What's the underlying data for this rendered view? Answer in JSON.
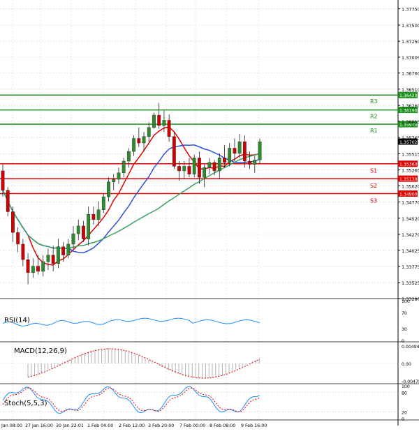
{
  "chart_data": {
    "type": "candlestick",
    "price": {
      "ylim": [
        1.3328,
        1.378
      ],
      "ticks": [
        "1.37750",
        "1.37500",
        "1.37250",
        "1.37005",
        "1.36760",
        "1.36510",
        "1.36260",
        "1.36015",
        "1.35765",
        "1.35515",
        "1.35265",
        "1.35020",
        "1.34770",
        "1.34520",
        "1.34270",
        "1.34025",
        "1.33775",
        "1.33525",
        "1.33280"
      ],
      "current": {
        "value": 1.35702,
        "label": "1.35702"
      },
      "levels": [
        {
          "name": "R3",
          "value": 1.3642,
          "label": "1.36420",
          "color": "#1a8f1a"
        },
        {
          "name": "R2",
          "value": 1.3619,
          "label": "1.36190",
          "color": "#1a8f1a"
        },
        {
          "name": "R1",
          "value": 1.3597,
          "label": "1.35970",
          "color": "#1a8f1a"
        },
        {
          "name": "S1",
          "value": 1.3536,
          "label": "1.35360",
          "color": "#e00000"
        },
        {
          "name": "S2",
          "value": 1.3513,
          "label": "1.35130",
          "color": "#e00000"
        },
        {
          "name": "S3",
          "value": 1.349,
          "label": "1.34900",
          "color": "#e00000"
        }
      ],
      "candles": [
        [
          1.3525,
          1.3535,
          1.3485,
          1.3495
        ],
        [
          1.3495,
          1.35,
          1.3455,
          1.3462
        ],
        [
          1.3462,
          1.347,
          1.3415,
          1.343
        ],
        [
          1.343,
          1.3438,
          1.34,
          1.3412
        ],
        [
          1.3412,
          1.342,
          1.3378,
          1.3388
        ],
        [
          1.3388,
          1.3398,
          1.335,
          1.3368
        ],
        [
          1.3368,
          1.339,
          1.336,
          1.3378
        ],
        [
          1.3378,
          1.3395,
          1.3365,
          1.337
        ],
        [
          1.337,
          1.3395,
          1.3362,
          1.3385
        ],
        [
          1.3385,
          1.3405,
          1.3372,
          1.3395
        ],
        [
          1.3395,
          1.341,
          1.337,
          1.3382
        ],
        [
          1.3382,
          1.342,
          1.3375,
          1.3408
        ],
        [
          1.3408,
          1.3415,
          1.3385,
          1.3395
        ],
        [
          1.3395,
          1.342,
          1.339,
          1.3412
        ],
        [
          1.3412,
          1.344,
          1.3405,
          1.3428
        ],
        [
          1.3428,
          1.345,
          1.3418,
          1.344
        ],
        [
          1.344,
          1.3448,
          1.3415,
          1.342
        ],
        [
          1.342,
          1.347,
          1.341,
          1.3458
        ],
        [
          1.3458,
          1.347,
          1.3442,
          1.345
        ],
        [
          1.345,
          1.3478,
          1.344,
          1.3465
        ],
        [
          1.3465,
          1.349,
          1.346,
          1.3485
        ],
        [
          1.3485,
          1.3515,
          1.3478,
          1.3508
        ],
        [
          1.3508,
          1.352,
          1.3495,
          1.3512
        ],
        [
          1.3512,
          1.353,
          1.3505,
          1.3522
        ],
        [
          1.3522,
          1.3545,
          1.3515,
          1.354
        ],
        [
          1.354,
          1.356,
          1.353,
          1.3555
        ],
        [
          1.3555,
          1.358,
          1.3548,
          1.3575
        ],
        [
          1.3575,
          1.3592,
          1.3562,
          1.3568
        ],
        [
          1.3568,
          1.3585,
          1.3555,
          1.3578
        ],
        [
          1.3578,
          1.36,
          1.357,
          1.3592
        ],
        [
          1.3592,
          1.3615,
          1.359,
          1.3611
        ],
        [
          1.3611,
          1.363,
          1.359,
          1.3595
        ],
        [
          1.3595,
          1.3618,
          1.3585,
          1.3603
        ],
        [
          1.3603,
          1.3612,
          1.357,
          1.3578
        ],
        [
          1.3578,
          1.3585,
          1.3528,
          1.3532
        ],
        [
          1.3532,
          1.354,
          1.351,
          1.3525
        ],
        [
          1.3525,
          1.354,
          1.3512,
          1.3532
        ],
        [
          1.3532,
          1.3545,
          1.3515,
          1.352
        ],
        [
          1.352,
          1.355,
          1.3515,
          1.3545
        ],
        [
          1.3545,
          1.3555,
          1.3505,
          1.3515
        ],
        [
          1.3515,
          1.3535,
          1.35,
          1.353
        ],
        [
          1.353,
          1.3545,
          1.352,
          1.3538
        ],
        [
          1.3538,
          1.3542,
          1.3518,
          1.3525
        ],
        [
          1.3525,
          1.3552,
          1.3512,
          1.3545
        ],
        [
          1.3545,
          1.3565,
          1.353,
          1.3538
        ],
        [
          1.3538,
          1.3568,
          1.3532,
          1.356
        ],
        [
          1.356,
          1.3575,
          1.354,
          1.3552
        ],
        [
          1.3552,
          1.3582,
          1.3545,
          1.357
        ],
        [
          1.357,
          1.358,
          1.353,
          1.354
        ],
        [
          1.354,
          1.3555,
          1.3528,
          1.3535
        ],
        [
          1.3535,
          1.3548,
          1.3522,
          1.3542
        ],
        [
          1.3542,
          1.3575,
          1.3535,
          1.357
        ]
      ]
    },
    "indicators": [
      {
        "name": "RSI(14)",
        "ticks": [
          "100",
          "70",
          "30",
          "0"
        ]
      },
      {
        "name": "MACD(12,26,9)",
        "ticks": [
          "0.004945",
          "0.00",
          "-0.004756"
        ]
      },
      {
        "name": "Stoch(5,5,3)",
        "ticks": [
          "100",
          "80",
          "20",
          "0"
        ]
      }
    ],
    "x_ticks": [
      "Jan 08:00",
      "27 Jan 16:00",
      "30 Jan 22:01",
      "1 Feb 04:00",
      "2 Feb 12:00",
      "3 Feb 20:00",
      "7 Feb 00:00",
      "8 Feb 08:00",
      "9 Feb 16:00"
    ],
    "colors": {
      "up": "#2e8b2e",
      "down": "#d00000",
      "ma_red": "#e00000",
      "ma_blue": "#3050e0",
      "ma_green": "#3aa060",
      "grid": "#d4d4d4",
      "indicator_line": "#1e90ff",
      "stoch_signal": "#e00000"
    }
  }
}
